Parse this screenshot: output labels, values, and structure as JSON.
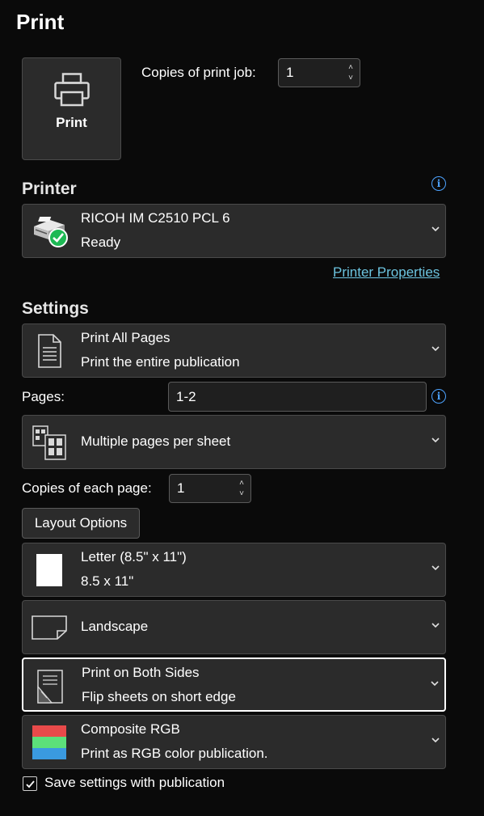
{
  "title": "Print",
  "print_button": {
    "label": "Print",
    "icon": "printer-icon"
  },
  "copies_job": {
    "label": "Copies of print job:",
    "value": "1"
  },
  "printer": {
    "heading": "Printer",
    "name": "RICOH IM C2510 PCL 6",
    "status": "Ready",
    "properties_link": "Printer Properties"
  },
  "settings": {
    "heading": "Settings",
    "range": {
      "title": "Print All Pages",
      "subtitle": "Print the entire publication"
    },
    "pages": {
      "label": "Pages:",
      "value": "1-2"
    },
    "layout": {
      "title": "Multiple pages per sheet"
    },
    "copies_page": {
      "label": "Copies of each page:",
      "value": "1"
    },
    "layout_options_label": "Layout Options",
    "paper": {
      "title": "Letter (8.5\" x 11\")",
      "subtitle": "8.5 x 11\""
    },
    "orientation": {
      "title": "Landscape"
    },
    "duplex": {
      "title": "Print on Both Sides",
      "subtitle": "Flip sheets on short edge"
    },
    "color": {
      "title": "Composite RGB",
      "subtitle": "Print as RGB color publication."
    },
    "save_settings": {
      "label": "Save settings with publication",
      "checked": true
    }
  },
  "colors": {
    "accent": "#4da3ff",
    "link": "#6cc4e0",
    "check_green": "#1db954"
  }
}
